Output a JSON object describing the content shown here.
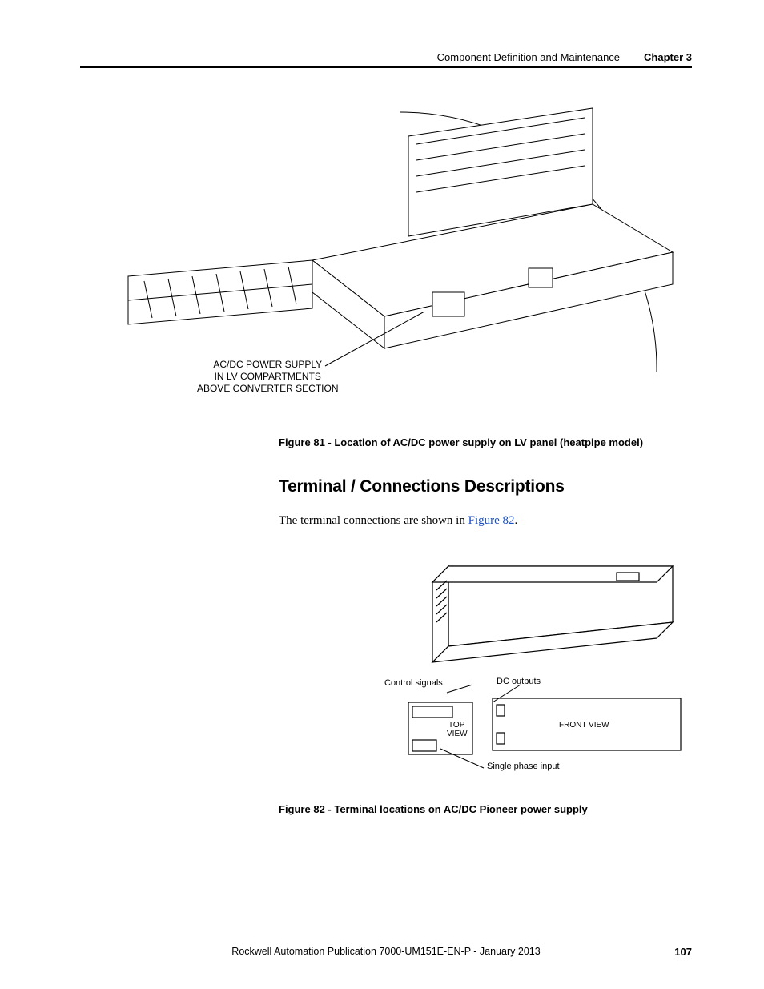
{
  "header": {
    "section": "Component Definition and Maintenance",
    "chapter": "Chapter 3"
  },
  "figure81": {
    "callout_line1": "AC/DC POWER SUPPLY",
    "callout_line2": "IN LV COMPARTMENTS",
    "callout_line3": "ABOVE CONVERTER SECTION",
    "caption": "Figure 81 - Location of AC/DC power supply on LV panel (heatpipe model)"
  },
  "section_title": "Terminal / Connections Descriptions",
  "body_text_pre": "The terminal connections are shown in ",
  "body_text_link": "Figure 82",
  "body_text_post": ".",
  "figure82": {
    "label_control": "Control signals",
    "label_dc": "DC outputs",
    "label_top": "TOP",
    "label_view": "VIEW",
    "label_front": "FRONT VIEW",
    "label_single": "Single phase input",
    "caption": "Figure 82 - Terminal locations on AC/DC Pioneer power supply"
  },
  "footer": {
    "pub": "Rockwell Automation Publication 7000-UM151E-EN-P - January 2013",
    "page": "107"
  }
}
